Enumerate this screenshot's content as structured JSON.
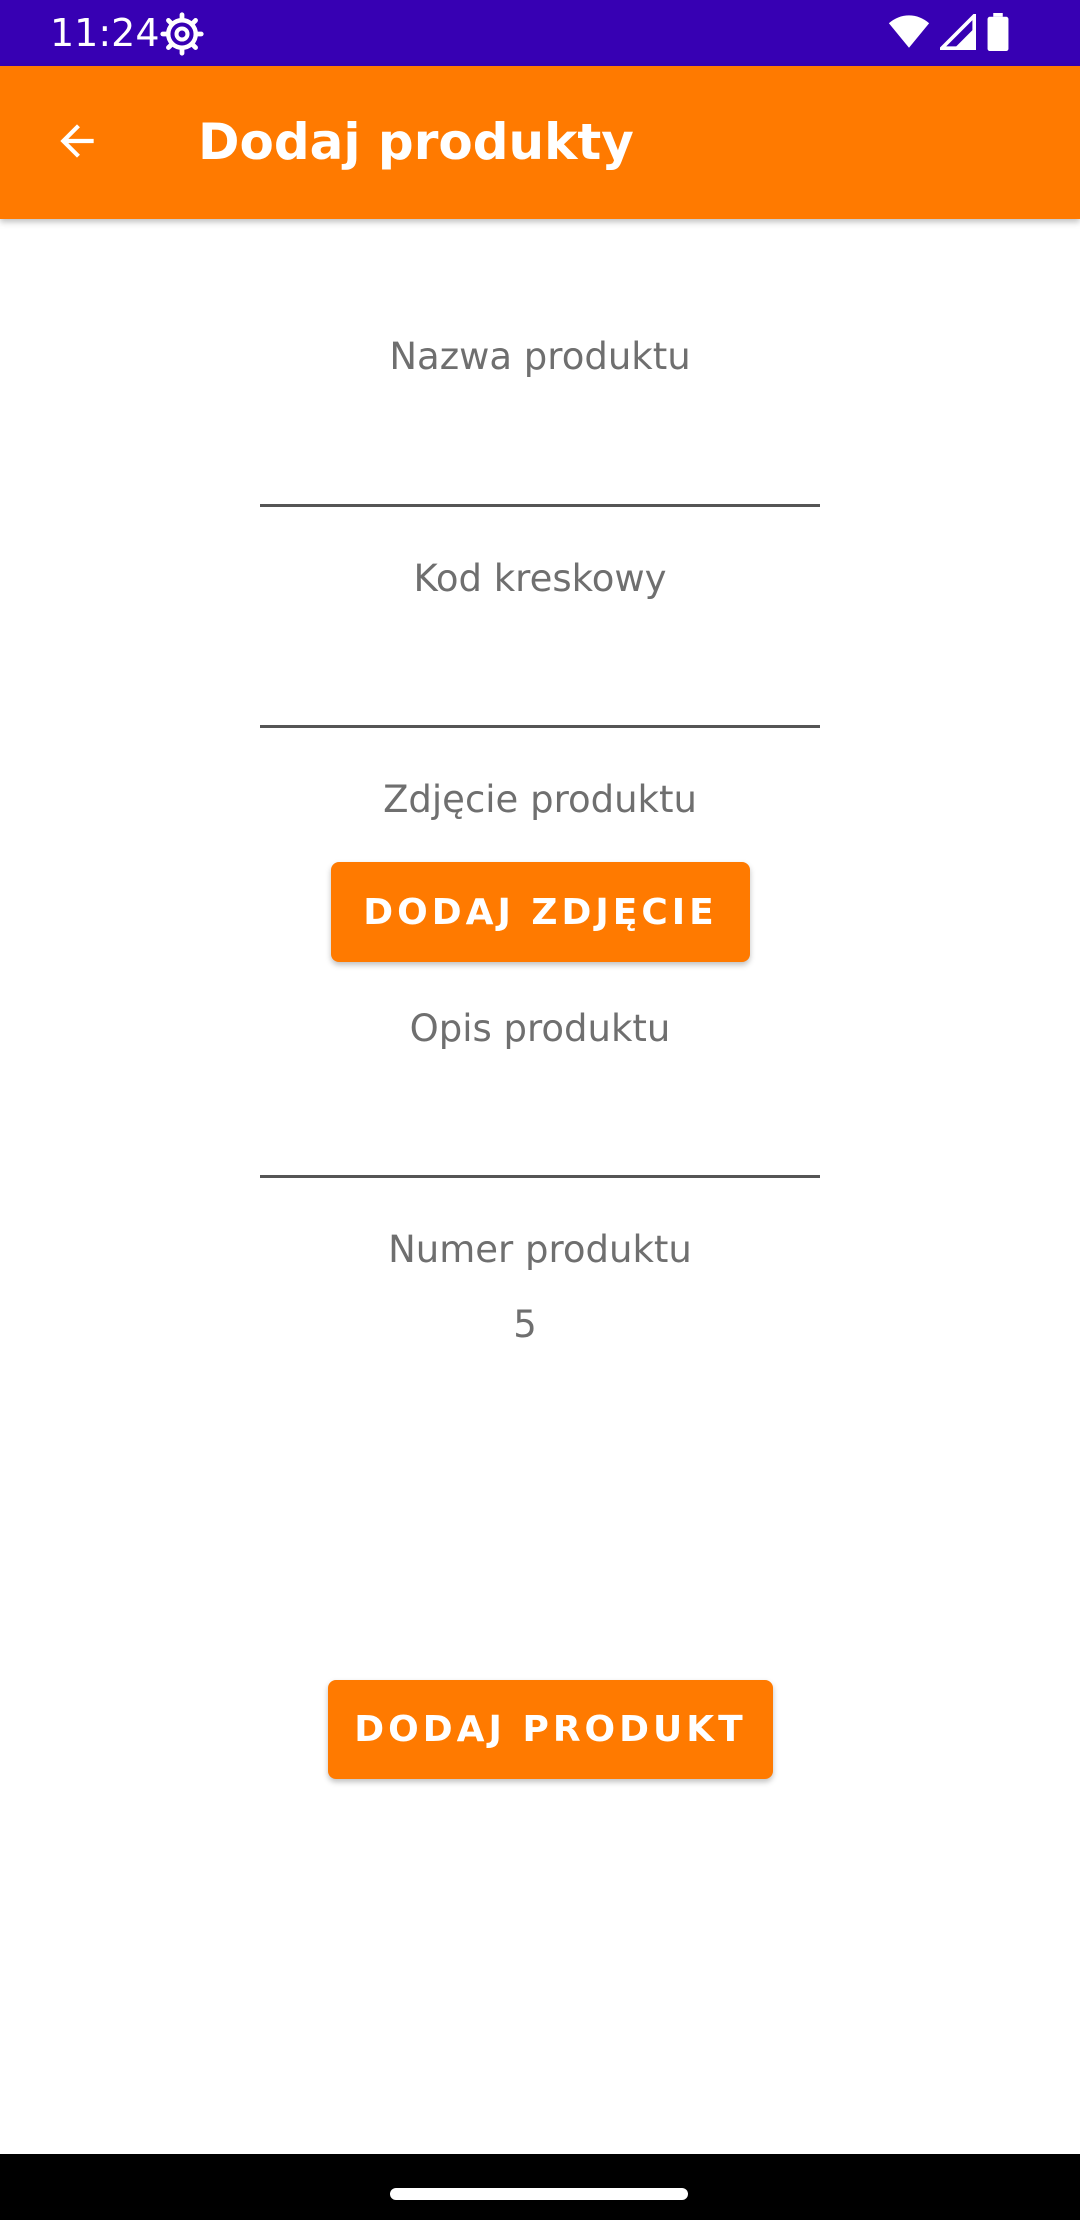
{
  "status_bar": {
    "time": "11:24",
    "icons": [
      "settings-icon",
      "wifi-icon",
      "signal-icon",
      "battery-icon"
    ]
  },
  "app_bar": {
    "title": "Dodaj produkty",
    "back_icon": "arrow-back-icon"
  },
  "form": {
    "name_label": "Nazwa produktu",
    "name_value": "",
    "barcode_label": "Kod kreskowy",
    "barcode_value": "",
    "photo_label": "Zdjęcie produktu",
    "add_photo_button": "DODAJ ZDJĘCIE",
    "description_label": "Opis produktu",
    "description_value": "",
    "number_label": "Numer produktu",
    "number_value": "5",
    "add_product_button": "DODAJ PRODUKT"
  },
  "colors": {
    "status_bar": "#3700b3",
    "accent": "#ff7a00",
    "text_secondary": "#6f6f6f"
  }
}
